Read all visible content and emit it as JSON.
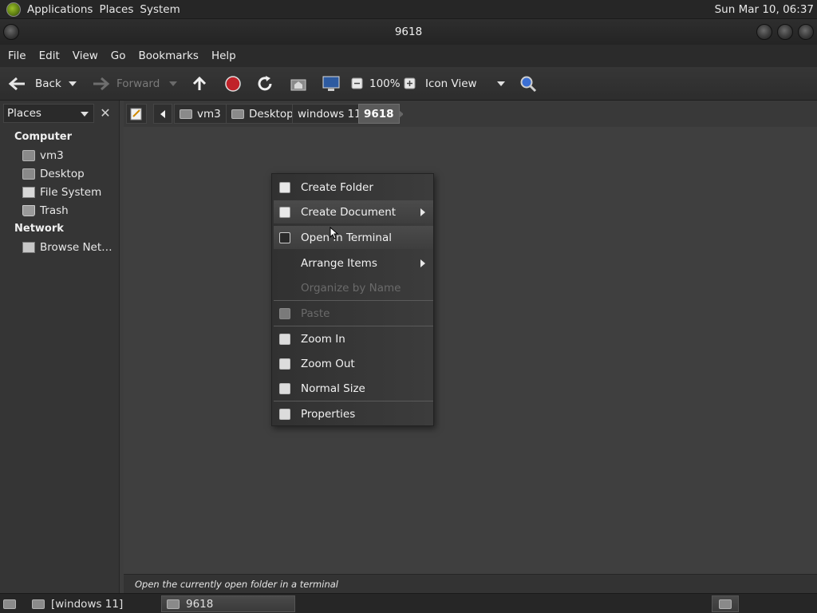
{
  "topbar": {
    "menus": [
      "Applications",
      "Places",
      "System"
    ],
    "clock": "Sun Mar 10, 06:37"
  },
  "window": {
    "title": "9618"
  },
  "menubar": {
    "items": [
      "File",
      "Edit",
      "View",
      "Go",
      "Bookmarks",
      "Help"
    ]
  },
  "toolbar": {
    "back_label": "Back",
    "forward_label": "Forward",
    "zoom_level": "100%",
    "view_mode": "Icon View"
  },
  "sidebar": {
    "header": "Places",
    "computer_label": "Computer",
    "computer_items": [
      "vm3",
      "Desktop",
      "File System",
      "Trash"
    ],
    "network_label": "Network",
    "network_items": [
      "Browse Net…"
    ]
  },
  "location": {
    "crumbs": [
      "vm3",
      "Desktop",
      "windows 11",
      "9618"
    ]
  },
  "context_menu": {
    "items": [
      {
        "label": "Create Folder",
        "enabled": true
      },
      {
        "label": "Create Document",
        "enabled": true,
        "submenu": true
      },
      {
        "label": "Open in Terminal",
        "enabled": true,
        "highlighted": true
      },
      {
        "label": "Arrange Items",
        "enabled": true,
        "submenu": true
      },
      {
        "label": "Organize by Name",
        "enabled": false
      },
      {
        "label": "Paste",
        "enabled": false
      },
      {
        "label": "Zoom In",
        "enabled": true
      },
      {
        "label": "Zoom Out",
        "enabled": true
      },
      {
        "label": "Normal Size",
        "enabled": true
      },
      {
        "label": "Properties",
        "enabled": true
      }
    ]
  },
  "statusbar": {
    "text": "Open the currently open folder in a terminal"
  },
  "taskbar": {
    "items": [
      "[windows 11]",
      "9618"
    ]
  }
}
